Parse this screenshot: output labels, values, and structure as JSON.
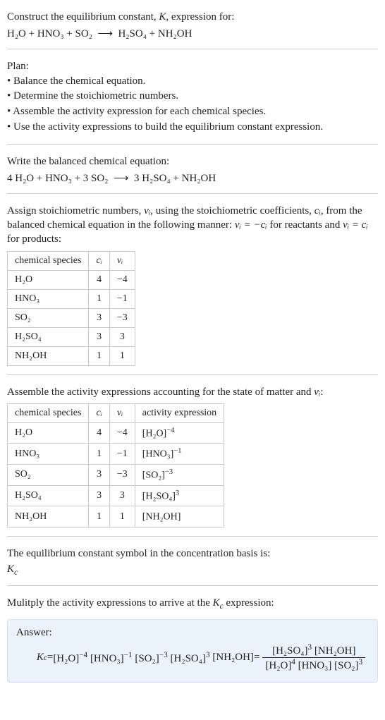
{
  "intro": {
    "line1_pre": "Construct the equilibrium constant, ",
    "line1_k": "K",
    "line1_post": ", expression for:",
    "eq_lhs": "H₂O + HNO₃ + SO₂",
    "arrow": "⟶",
    "eq_rhs": "H₂SO₄ + NH₂OH"
  },
  "plan": {
    "title": "Plan:",
    "b1": "• Balance the chemical equation.",
    "b2": "• Determine the stoichiometric numbers.",
    "b3": "• Assemble the activity expression for each chemical species.",
    "b4": "• Use the activity expressions to build the equilibrium constant expression."
  },
  "balanced": {
    "title": "Write the balanced chemical equation:",
    "eq_lhs": "4 H₂O + HNO₃ + 3 SO₂",
    "arrow": "⟶",
    "eq_rhs": "3 H₂SO₄ + NH₂OH"
  },
  "assign": {
    "text_pre": "Assign stoichiometric numbers, ",
    "nu": "νᵢ",
    "text_mid1": ", using the stoichiometric coefficients, ",
    "ci": "cᵢ",
    "text_mid2": ", from the balanced chemical equation in the following manner: ",
    "rule_react": "νᵢ = −cᵢ",
    "text_mid3": " for reactants and ",
    "rule_prod": "νᵢ = cᵢ",
    "text_mid4": " for products:"
  },
  "stoich_table": {
    "h1": "chemical species",
    "h2": "cᵢ",
    "h3": "νᵢ",
    "rows": [
      {
        "sp": "H₂O",
        "c": "4",
        "n": "−4"
      },
      {
        "sp": "HNO₃",
        "c": "1",
        "n": "−1"
      },
      {
        "sp": "SO₂",
        "c": "3",
        "n": "−3"
      },
      {
        "sp": "H₂SO₄",
        "c": "3",
        "n": "3"
      },
      {
        "sp": "NH₂OH",
        "c": "1",
        "n": "1"
      }
    ]
  },
  "assemble": {
    "text_pre": "Assemble the activity expressions accounting for the state of matter and ",
    "nu": "νᵢ",
    "text_post": ":"
  },
  "act_table": {
    "h1": "chemical species",
    "h2": "cᵢ",
    "h3": "νᵢ",
    "h4": "activity expression",
    "rows": [
      {
        "sp": "H₂O",
        "c": "4",
        "n": "−4",
        "base": "[H₂O]",
        "exp": "−4"
      },
      {
        "sp": "HNO₃",
        "c": "1",
        "n": "−1",
        "base": "[HNO₃]",
        "exp": "−1"
      },
      {
        "sp": "SO₂",
        "c": "3",
        "n": "−3",
        "base": "[SO₂]",
        "exp": "−3"
      },
      {
        "sp": "H₂SO₄",
        "c": "3",
        "n": "3",
        "base": "[H₂SO₄]",
        "exp": "3"
      },
      {
        "sp": "NH₂OH",
        "c": "1",
        "n": "1",
        "base": "[NH₂OH]",
        "exp": ""
      }
    ]
  },
  "symbol": {
    "line": "The equilibrium constant symbol in the concentration basis is:",
    "kc_k": "K",
    "kc_c": "c"
  },
  "mult": {
    "text_pre": "Mulitply the activity expressions to arrive at the ",
    "kc_k": "K",
    "kc_c": "c",
    "text_post": " expression:"
  },
  "answer": {
    "label": "Answer:",
    "kc_k": "K",
    "kc_c": "c",
    "eq": " = ",
    "t1_base": "[H₂O]",
    "t1_exp": "−4",
    "t2_base": "[HNO₃]",
    "t2_exp": "−1",
    "t3_base": "[SO₂]",
    "t3_exp": "−3",
    "t4_base": "[H₂SO₄]",
    "t4_exp": "3",
    "t5_base": "[NH₂OH]",
    "eq2": " = ",
    "num1_base": "[H₂SO₄]",
    "num1_exp": "3",
    "num2_base": "[NH₂OH]",
    "den1_base": "[H₂O]",
    "den1_exp": "4",
    "den2_base": "[HNO₃]",
    "den3_base": "[SO₂]",
    "den3_exp": "3"
  }
}
